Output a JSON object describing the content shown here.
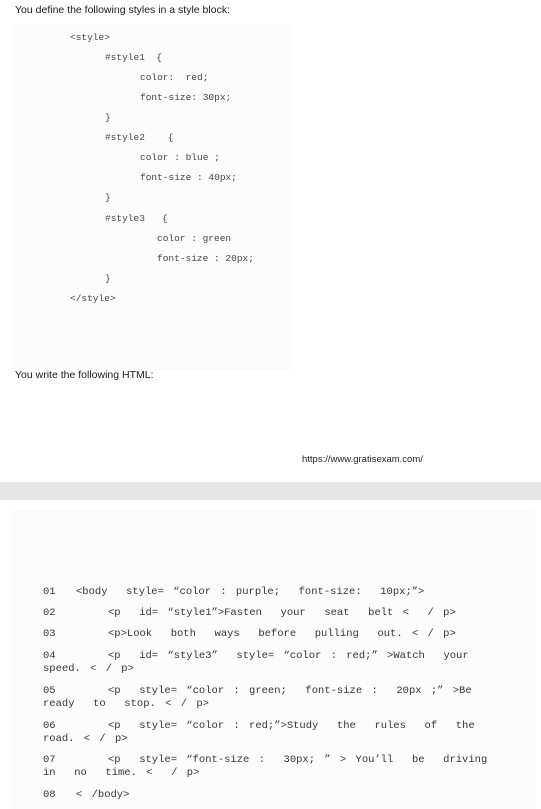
{
  "intro": "You define the following styles in a style block:",
  "style_block": [
    "<style>",
    "#style1  {",
    "color:  red;",
    "font-size: 30px;",
    "}",
    "#style2    {",
    "color : blue ;",
    "font-size : 40px;",
    "}",
    "#style3   {",
    "color : green",
    "font-size : 20px;",
    "}",
    "</style>"
  ],
  "html_intro": "You write the following HTML:",
  "watermark_url": "https://www.gratisexam.com/",
  "html_lines": [
    {
      "num": "01",
      "code": "<body  style= “color : purple;  font-size:  10px;”>"
    },
    {
      "num": "02",
      "code": "<p  id= “style1”>Fasten  your  seat  belt <  / p>"
    },
    {
      "num": "03",
      "code": "<p>Look  both  ways  before  pulling  out. < / p>"
    },
    {
      "num": "04",
      "code": "<p  id= “style3”  style= “color : red;” >Watch  your",
      "cont": "speed. < / p>"
    },
    {
      "num": "05",
      "code": "<p  style= “color : green;  font-size :  20px ;” >Be",
      "cont": "ready  to  stop. < / p>"
    },
    {
      "num": "06",
      "code": "<p  style= “color : red;”>Study  the  rules  of  the",
      "cont": "road. < / p>"
    },
    {
      "num": "07",
      "code": "<p  style= “font-size :  30px; ” > You’ll  be  driving",
      "cont": "in  no  time. <  / p>"
    },
    {
      "num": "08",
      "code": "< /body>"
    }
  ]
}
